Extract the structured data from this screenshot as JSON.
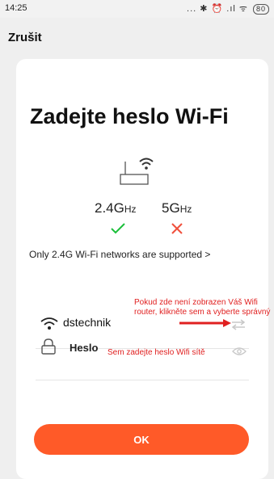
{
  "status_bar": {
    "time": "14:25",
    "icons": "... ✱ ⏰ .ıl ᯤ",
    "battery": "80"
  },
  "header": {
    "cancel_label": "Zrušit"
  },
  "page": {
    "title": "Zadejte heslo Wi-Fi",
    "band_24": "2.4G",
    "band_5": "5G",
    "band_unit": "Hz",
    "support_note": "Only 2.4G Wi-Fi networks are supported >"
  },
  "wifi": {
    "ssid": "dstechnik"
  },
  "password": {
    "value": "Heslo"
  },
  "annotations": {
    "wifi_hint": "Pokud zde není zobrazen Váš Wifi router, klikněte sem a vyberte správný",
    "password_hint": "Sem zadejte heslo Wifi sítě"
  },
  "actions": {
    "ok_label": "OK"
  },
  "colors": {
    "accent": "#ff5a28",
    "annotation": "#e02020",
    "check": "#1bbf3a",
    "cross": "#f0503c"
  }
}
